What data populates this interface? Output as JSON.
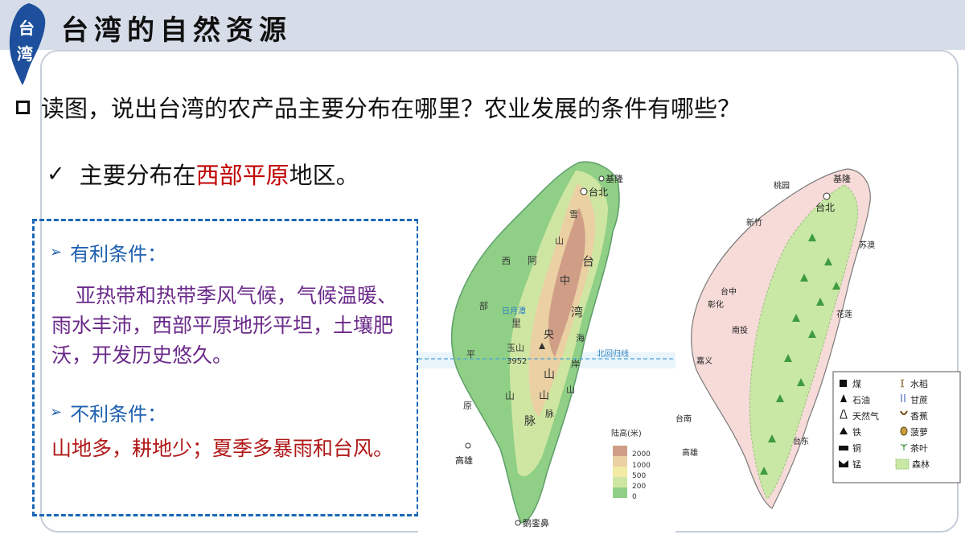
{
  "header": {
    "logo_text_1": "台",
    "logo_text_2": "湾",
    "title": "台湾的自然资源"
  },
  "question": "读图，说出台湾的农产品主要分布在哪里？农业发展的条件有哪些？",
  "answer": {
    "prefix": "主要分布在",
    "highlight": "西部平原",
    "suffix": "地区。"
  },
  "conditions": {
    "favorable_title": "有利条件：",
    "favorable_text": "亚热带和热带季风气候，气候温暖、雨水丰沛，西部平原地形平坦，土壤肥沃，开发历史悠久。",
    "unfavorable_title": "不利条件：",
    "unfavorable_text": "山地多，耕地少；夏季多暴雨和台风。"
  },
  "terrain_map": {
    "cities": [
      "基隆",
      "台北",
      "高雄",
      "鹅銮鼻"
    ],
    "mountains": [
      "雪",
      "山",
      "山",
      "脉"
    ],
    "central": [
      "中",
      "央",
      "山",
      "山",
      "脉"
    ],
    "taiwan_range": [
      "台",
      "湾",
      "海",
      "岸",
      "山",
      "脉"
    ],
    "alishan": [
      "阿",
      "里",
      "山"
    ],
    "plain": [
      "西",
      "部",
      "平",
      "原"
    ],
    "peak": "玉山",
    "peak_height": "3952",
    "lake": "日月潭",
    "tropic": "北回归线",
    "rivers": [
      "浊",
      "水",
      "溪",
      "淡",
      "水",
      "河",
      "下",
      "淡",
      "水",
      "溪",
      "兰",
      "阳",
      "溪"
    ],
    "legend_title": "陆高(米)",
    "legend_values": [
      "2000",
      "1000",
      "500",
      "200",
      "0"
    ],
    "legend_colors": [
      "#d09e86",
      "#ead0a3",
      "#f3eaa6",
      "#cfe6a3",
      "#8fcf86"
    ]
  },
  "resource_map": {
    "cities": [
      "基隆",
      "台北",
      "桃园",
      "新竹",
      "苏澳",
      "台中",
      "彰化",
      "南投",
      "花莲",
      "嘉义",
      "台南",
      "高雄",
      "台东"
    ],
    "legend": [
      {
        "icon": "coal-icon",
        "label": "煤"
      },
      {
        "icon": "rice-icon",
        "label": "水稻"
      },
      {
        "icon": "oil-icon",
        "label": "石油"
      },
      {
        "icon": "sugarcane-icon",
        "label": "甘蔗"
      },
      {
        "icon": "gas-icon",
        "label": "天然气"
      },
      {
        "icon": "banana-icon",
        "label": "香蕉"
      },
      {
        "icon": "iron-icon",
        "label": "铁"
      },
      {
        "icon": "pineapple-icon",
        "label": "菠萝"
      },
      {
        "icon": "copper-icon",
        "label": "铜"
      },
      {
        "icon": "tea-icon",
        "label": "茶叶"
      },
      {
        "icon": "manganese-icon",
        "label": "锰"
      },
      {
        "icon": "forest-icon",
        "label": "森林"
      }
    ]
  }
}
